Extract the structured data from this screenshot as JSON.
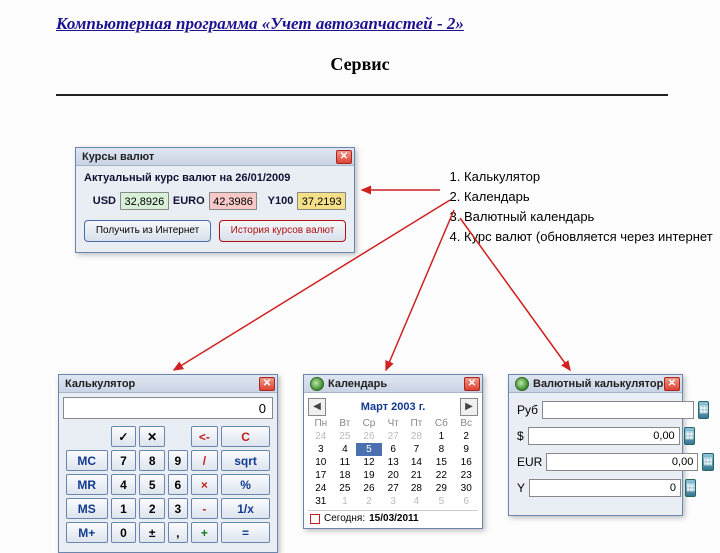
{
  "page_title": "Компьютерная программа «Учет автозапчастей - 2»",
  "section_title": "Сервис",
  "features": [
    "Калькулятор",
    "Календарь",
    "Валютный календарь",
    "Курс валют (обновляется через интернет"
  ],
  "rates": {
    "title": "Курсы валют",
    "heading_label": "Актуальный курс валют на",
    "date": "26/01/2009",
    "usd": {
      "label": "USD",
      "value": "32,8926",
      "color": "#d8efd8"
    },
    "eur": {
      "label": "EURO",
      "value": "42,3986",
      "color": "#f6c8c8"
    },
    "y100": {
      "label": "Y100",
      "value": "37,2193",
      "color": "#f5e08a"
    },
    "btn_fetch": "Получить из Интернет",
    "btn_history": "История курсов валют"
  },
  "calculator": {
    "title": "Калькулятор",
    "display": "0",
    "keys": {
      "check": "✓",
      "x1": "✕",
      "back": "<-",
      "c": "C",
      "mc": "MC",
      "mr": "MR",
      "ms": "MS",
      "mp": "M+",
      "n7": "7",
      "n8": "8",
      "n9": "9",
      "div": "/",
      "sqrt": "sqrt",
      "n4": "4",
      "n5": "5",
      "n6": "6",
      "mul": "×",
      "pct": "%",
      "n1": "1",
      "n2": "2",
      "n3": "3",
      "sub": "-",
      "inv": "1/x",
      "n0": "0",
      "pm": "±",
      "dot": ",",
      "add": "+",
      "eq": "="
    }
  },
  "calendar": {
    "title": "Календарь",
    "month": "Март 2003 г.",
    "dow": [
      "Пн",
      "Вт",
      "Ср",
      "Чт",
      "Пт",
      "Сб",
      "Вс"
    ],
    "grid": [
      [
        {
          "d": "24",
          "out": true
        },
        {
          "d": "25",
          "out": true
        },
        {
          "d": "26",
          "out": true
        },
        {
          "d": "27",
          "out": true
        },
        {
          "d": "28",
          "out": true
        },
        {
          "d": "1"
        },
        {
          "d": "2"
        }
      ],
      [
        {
          "d": "3"
        },
        {
          "d": "4"
        },
        {
          "d": "5",
          "sel": true
        },
        {
          "d": "6"
        },
        {
          "d": "7"
        },
        {
          "d": "8"
        },
        {
          "d": "9"
        }
      ],
      [
        {
          "d": "10"
        },
        {
          "d": "11"
        },
        {
          "d": "12"
        },
        {
          "d": "13"
        },
        {
          "d": "14"
        },
        {
          "d": "15"
        },
        {
          "d": "16"
        }
      ],
      [
        {
          "d": "17"
        },
        {
          "d": "18"
        },
        {
          "d": "19"
        },
        {
          "d": "20"
        },
        {
          "d": "21"
        },
        {
          "d": "22"
        },
        {
          "d": "23"
        }
      ],
      [
        {
          "d": "24"
        },
        {
          "d": "25"
        },
        {
          "d": "26"
        },
        {
          "d": "27"
        },
        {
          "d": "28"
        },
        {
          "d": "29"
        },
        {
          "d": "30"
        }
      ],
      [
        {
          "d": "31"
        },
        {
          "d": "1",
          "out": true
        },
        {
          "d": "2",
          "out": true
        },
        {
          "d": "3",
          "out": true
        },
        {
          "d": "4",
          "out": true
        },
        {
          "d": "5",
          "out": true
        },
        {
          "d": "6",
          "out": true
        }
      ]
    ],
    "today_label": "Сегодня:",
    "today_value": "15/03/2011"
  },
  "ccalc": {
    "title": "Валютный калькулятор",
    "rows": [
      {
        "label": "Руб",
        "value": ""
      },
      {
        "label": "$",
        "value": "0,00"
      },
      {
        "label": "EUR",
        "value": "0,00"
      },
      {
        "label": "Y",
        "value": "0"
      }
    ],
    "mini_icon": "▦"
  }
}
